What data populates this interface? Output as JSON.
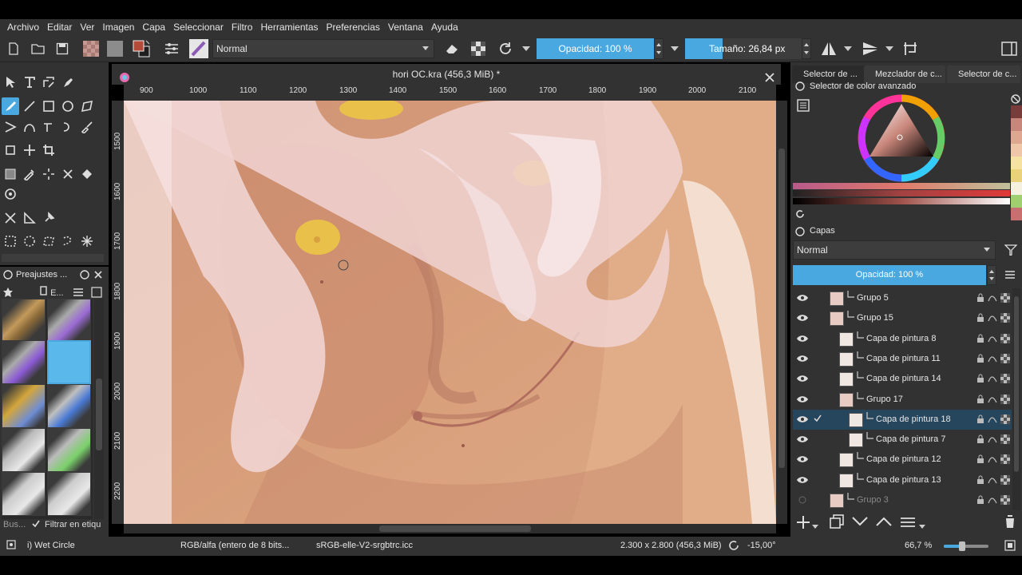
{
  "menu": [
    "Archivo",
    "Editar",
    "Ver",
    "Imagen",
    "Capa",
    "Seleccionar",
    "Filtro",
    "Herramientas",
    "Preferencias",
    "Ventana",
    "Ayuda"
  ],
  "toolbar": {
    "blend_mode": "Normal",
    "opacity_label": "Opacidad: 100 %",
    "size_label": "Tamaño: 26,84 px",
    "size_fraction": 0.32
  },
  "document": {
    "tab_title": "hori OC.kra (456,3 MiB) *",
    "ruler_x": [
      "900",
      "1000",
      "1100",
      "1200",
      "1300",
      "1400",
      "1500",
      "1600",
      "1700",
      "1800",
      "1900",
      "2000",
      "2100"
    ],
    "ruler_y": [
      "1500",
      "1600",
      "1700",
      "1800",
      "1900",
      "2000",
      "2100",
      "2200"
    ]
  },
  "presets": {
    "title": "Preajustes ...",
    "tag_label": "E...",
    "search_label": "Bus...",
    "filter_label": "Filtrar en etiqu"
  },
  "color_docker": {
    "tabs": [
      "Selector de ...",
      "Mezclador de c...",
      "Selector de c..."
    ],
    "title": "Selector de color avanzado",
    "swatches": [
      "#7a3b3b",
      "#c9867a",
      "#dfa690",
      "#efc6a8",
      "#f5e2a0",
      "#e9d27a",
      "#f6f0e0",
      "#9fcf6f",
      "#c96f6f"
    ]
  },
  "layers_docker": {
    "title": "Capas",
    "blend_mode": "Normal",
    "opacity_label": "Opacidad:  100 %",
    "rows": [
      {
        "name": "Grupo 5",
        "visible": true,
        "indent": 0
      },
      {
        "name": "Grupo 15",
        "visible": true,
        "indent": 0
      },
      {
        "name": "Capa de pintura 8",
        "visible": true,
        "indent": 1
      },
      {
        "name": "Capa de pintura 11",
        "visible": true,
        "indent": 1
      },
      {
        "name": "Capa de pintura 14",
        "visible": true,
        "indent": 1
      },
      {
        "name": "Grupo 17",
        "visible": true,
        "indent": 1
      },
      {
        "name": "Capa de pintura 18",
        "visible": true,
        "indent": 2,
        "selected": true
      },
      {
        "name": "Capa de pintura 7",
        "visible": true,
        "indent": 2
      },
      {
        "name": "Capa de pintura 12",
        "visible": true,
        "indent": 1
      },
      {
        "name": "Capa de pintura 13",
        "visible": true,
        "indent": 1
      },
      {
        "name": "Grupo 3",
        "visible": false,
        "indent": 0
      }
    ]
  },
  "status": {
    "brush": "i) Wet Circle",
    "color_model": "RGB/alfa (entero de 8 bits...",
    "profile": "sRGB-elle-V2-srgbtrc.icc",
    "dimensions": "2.300 x 2.800 (456,3 MiB)",
    "rotation": "-15,00°",
    "zoom": "66,7 %",
    "zoom_fraction": 0.38
  },
  "colors": {
    "accent": "#4aa8e0",
    "panel": "#323232",
    "selected_row": "#26465d"
  }
}
